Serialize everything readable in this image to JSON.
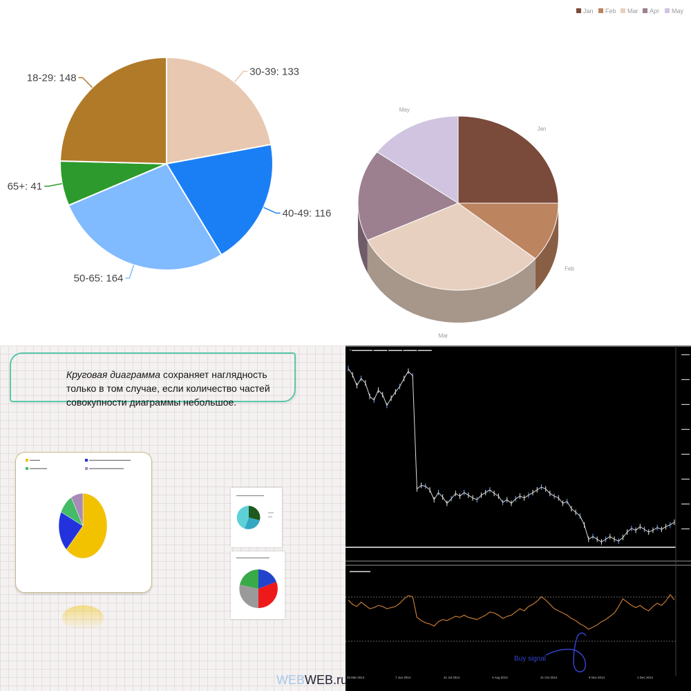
{
  "chart_data": [
    {
      "type": "pie",
      "categories": [
        "30-39",
        "40-49",
        "50-65",
        "65+",
        "18-29"
      ],
      "values": [
        133,
        116,
        164,
        41,
        148
      ],
      "data_labels": [
        "30-39: 133",
        "40-49: 116",
        "50-65: 164",
        "65+: 41",
        "18-29: 148"
      ],
      "colors": [
        "#e8c8b0",
        "#1a7ff5",
        "#80baff",
        "#2c9a2c",
        "#b07a28"
      ]
    },
    {
      "type": "pie",
      "categories": [
        "Jan",
        "Feb",
        "Mar",
        "Apr",
        "May"
      ],
      "values": [
        25,
        11,
        32,
        17,
        15
      ],
      "colors": [
        "#7a4a3a",
        "#bd8460",
        "#e8d0c0",
        "#9c8090",
        "#d0c4e0"
      ],
      "legend": "top-right",
      "legend_entries": [
        "Jan",
        "Feb",
        "Mar",
        "Apr",
        "May"
      ],
      "style": "3d"
    },
    {
      "type": "pie",
      "values": [
        62,
        20,
        10,
        8
      ],
      "colors": [
        "#f2c200",
        "#2233dd",
        "#44bb66",
        "#a88ab8"
      ]
    },
    {
      "type": "line",
      "series": [
        {
          "values": [
            1.582,
            1.575,
            1.563,
            1.571,
            1.566,
            1.551,
            1.547,
            1.558,
            1.553,
            1.541,
            1.549,
            1.556,
            1.562,
            1.571,
            1.579,
            1.574,
            1.448,
            1.452,
            1.451,
            1.447,
            1.436,
            1.444,
            1.439,
            1.432,
            1.437,
            1.443,
            1.44,
            1.444,
            1.441,
            1.438,
            1.436,
            1.441,
            1.444,
            1.447,
            1.443,
            1.44,
            1.433,
            1.436,
            1.432,
            1.437,
            1.44,
            1.438,
            1.441,
            1.444,
            1.447,
            1.45,
            1.448,
            1.443,
            1.44,
            1.438,
            1.432,
            1.434,
            1.426,
            1.422,
            1.418,
            1.408,
            1.392,
            1.395,
            1.392,
            1.389,
            1.392,
            1.395,
            1.392,
            1.39,
            1.394,
            1.4,
            1.404,
            1.402,
            1.406,
            1.403,
            1.4,
            1.402,
            1.405,
            1.403,
            1.406,
            1.408,
            1.411
          ]
        },
        {
          "values": [
            52,
            48,
            46,
            50,
            47,
            44,
            45,
            47,
            46,
            44,
            45,
            46,
            49,
            53,
            56,
            55,
            36,
            33,
            31,
            30,
            28,
            32,
            34,
            33,
            35,
            37,
            36,
            38,
            36,
            35,
            34,
            36,
            38,
            41,
            40,
            38,
            35,
            37,
            38,
            41,
            44,
            42,
            46,
            48,
            51,
            55,
            52,
            48,
            44,
            42,
            40,
            38,
            35,
            33,
            30,
            28,
            25,
            27,
            29,
            32,
            34,
            37,
            40,
            46,
            53,
            50,
            47,
            45,
            47,
            44,
            42,
            46,
            49,
            47,
            51,
            57,
            52
          ]
        }
      ],
      "x": [
        "20 Mar 2014",
        "7 Jun 2014",
        "21 Jul 2014",
        "4 Aug 2014",
        "21 Oct 2014",
        "9 Nov 2014",
        "1 Dec 2014"
      ],
      "annotations": [
        "Buy signal"
      ]
    }
  ],
  "q3": {
    "callout_em": "Круговая диаграмма",
    "callout_rest": " сохраняет наглядность только в том случае, если количество частей совокупности диаграммы небольшое.",
    "brand_prefix": "WEB",
    "brand_suffix": "WEB.ru"
  }
}
